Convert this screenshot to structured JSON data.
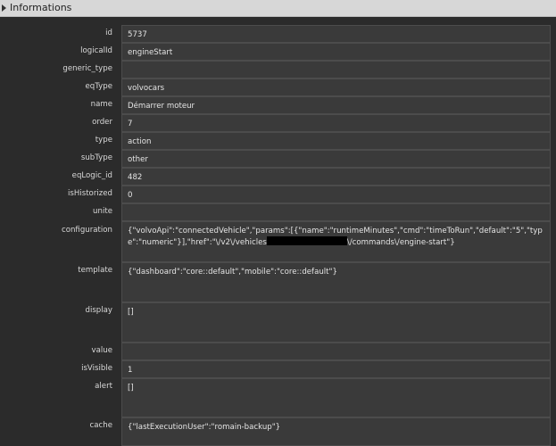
{
  "header": {
    "title": "Informations",
    "chevron_icon": "chevron-right-icon"
  },
  "rows": [
    {
      "key": "id",
      "value": "5737"
    },
    {
      "key": "logicalId",
      "value": "engineStart"
    },
    {
      "key": "generic_type",
      "value": ""
    },
    {
      "key": "eqType",
      "value": "volvocars"
    },
    {
      "key": "name",
      "value": "Démarrer moteur"
    },
    {
      "key": "order",
      "value": "7"
    },
    {
      "key": "type",
      "value": "action"
    },
    {
      "key": "subType",
      "value": "other"
    },
    {
      "key": "eqLogic_id",
      "value": "482"
    },
    {
      "key": "isHistorized",
      "value": "0"
    },
    {
      "key": "unite",
      "value": ""
    },
    {
      "key": "configuration",
      "value_part1": "{\"volvoApi\":\"connectedVehicle\",\"params\":[{\"name\":\"runtimeMinutes\",\"cmd\":\"timeToRun\",\"default\":\"5\",\"type\":\"numeric\"}],\"href\":\"\\/v2\\/vehicles",
      "value_part2": "\\/commands\\/engine-start\"}"
    },
    {
      "key": "template",
      "value": "{\"dashboard\":\"core::default\",\"mobile\":\"core::default\"}"
    },
    {
      "key": "display",
      "value": "[]"
    },
    {
      "key": "value",
      "value": ""
    },
    {
      "key": "isVisible",
      "value": "1"
    },
    {
      "key": "alert",
      "value": "[]"
    },
    {
      "key": "cache",
      "value": "{\"lastExecutionUser\":\"romain-backup\"}"
    }
  ]
}
